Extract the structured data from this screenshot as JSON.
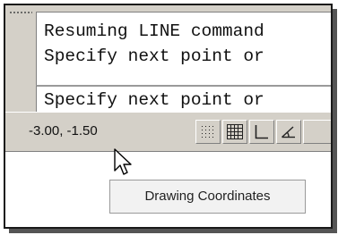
{
  "command_line": {
    "history": [
      "Resuming LINE command",
      "Specify next point or"
    ],
    "prompt": "Specify next point or"
  },
  "status_bar": {
    "coordinates": "-3.00, -1.50",
    "buttons": [
      {
        "name": "snap-mode-button",
        "icon": "snap-dots-icon"
      },
      {
        "name": "grid-display-button",
        "icon": "grid-icon"
      },
      {
        "name": "ortho-mode-button",
        "icon": "ortho-icon"
      },
      {
        "name": "polar-tracking-button",
        "icon": "polar-icon"
      }
    ]
  },
  "tooltip": {
    "text": "Drawing Coordinates"
  }
}
